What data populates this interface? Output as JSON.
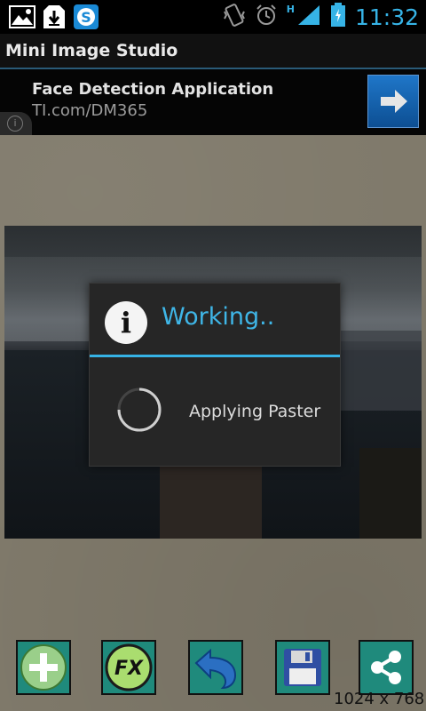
{
  "status_bar": {
    "time": "11:32",
    "network": "H",
    "left_icons": [
      "image-icon",
      "download-icon",
      "skype-icon"
    ],
    "right_icons": [
      "vibrate-icon",
      "alarm-icon",
      "signal-icon",
      "battery-charging-icon"
    ]
  },
  "app": {
    "title": "Mini Image Studio"
  },
  "ad": {
    "title": "Face Detection Application",
    "url": "TI.com/DM365",
    "icon": "arrow-right-icon",
    "info_icon": "info-icon"
  },
  "dialog": {
    "title": "Working..",
    "message": "Applying Paster",
    "icon": "info-icon",
    "accent": "#36b3e6"
  },
  "toolbar": {
    "buttons": [
      {
        "name": "add",
        "icon": "plus-icon"
      },
      {
        "name": "fx",
        "label": "FX",
        "icon": "fx-icon"
      },
      {
        "name": "undo",
        "icon": "undo-icon"
      },
      {
        "name": "save",
        "icon": "floppy-icon"
      },
      {
        "name": "share",
        "icon": "share-icon"
      }
    ]
  },
  "resolution": "1024 x 768"
}
